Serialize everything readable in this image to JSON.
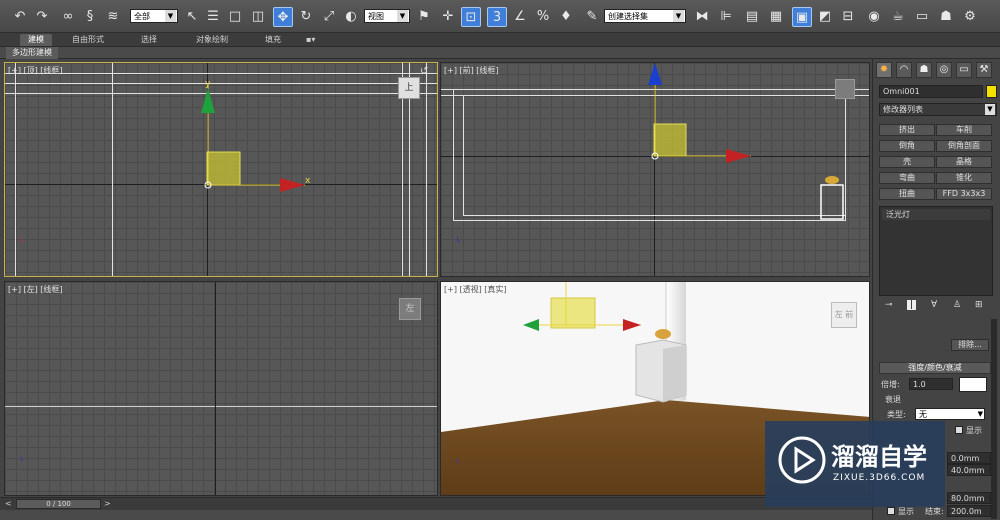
{
  "toolbar": {
    "selection_filter": "全部",
    "ref_coord": "视图",
    "named_selection": "创建选择集"
  },
  "ribbon": {
    "tabs": [
      "建模",
      "自由形式",
      "选择",
      "对象绘制",
      "填充"
    ],
    "sub_label": "多边形建模"
  },
  "viewports": {
    "top": {
      "plus": "[+]",
      "name": "[顶]",
      "mode": "[线框]",
      "cube": "上"
    },
    "front": {
      "plus": "[+]",
      "name": "[前]",
      "mode": "[线框]"
    },
    "left": {
      "plus": "[+]",
      "name": "[左]",
      "mode": "[线框]",
      "cube": "左"
    },
    "persp": {
      "plus": "[+]",
      "name": "[透视]",
      "mode": "[真实]",
      "cube_a": "左",
      "cube_b": "前"
    }
  },
  "axes": {
    "x": "x",
    "y": "y"
  },
  "command_panel": {
    "object_name": "Omni001",
    "object_color": "#f5e000",
    "modifier_list": "修改器列表",
    "modifiers": [
      "挤出",
      "车削",
      "倒角",
      "倒角剖面",
      "壳",
      "晶格",
      "弯曲",
      "锥化",
      "扭曲",
      "FFD 3x3x3"
    ],
    "stack_item": "泛光灯",
    "exclude_button": "排除...",
    "intensity_rollout": "强度/颜色/衰减",
    "multiplier_label": "倍增:",
    "multiplier_value": "1.0",
    "multiplier_color": "#ffffff",
    "decay_label": "衰退",
    "type_label": "类型:",
    "type_value": "无",
    "show_label": "显示",
    "near_start": "0.0mm",
    "near_end": "40.0mm",
    "far_start": "80.0mm",
    "far_show_label": "显示",
    "far_end_label": "结束:",
    "far_end": "200.0m"
  },
  "timeline": {
    "frame": "0 / 100"
  },
  "watermark": {
    "title": "溜溜自学",
    "url": "ZIXUE.3D66.COM"
  }
}
